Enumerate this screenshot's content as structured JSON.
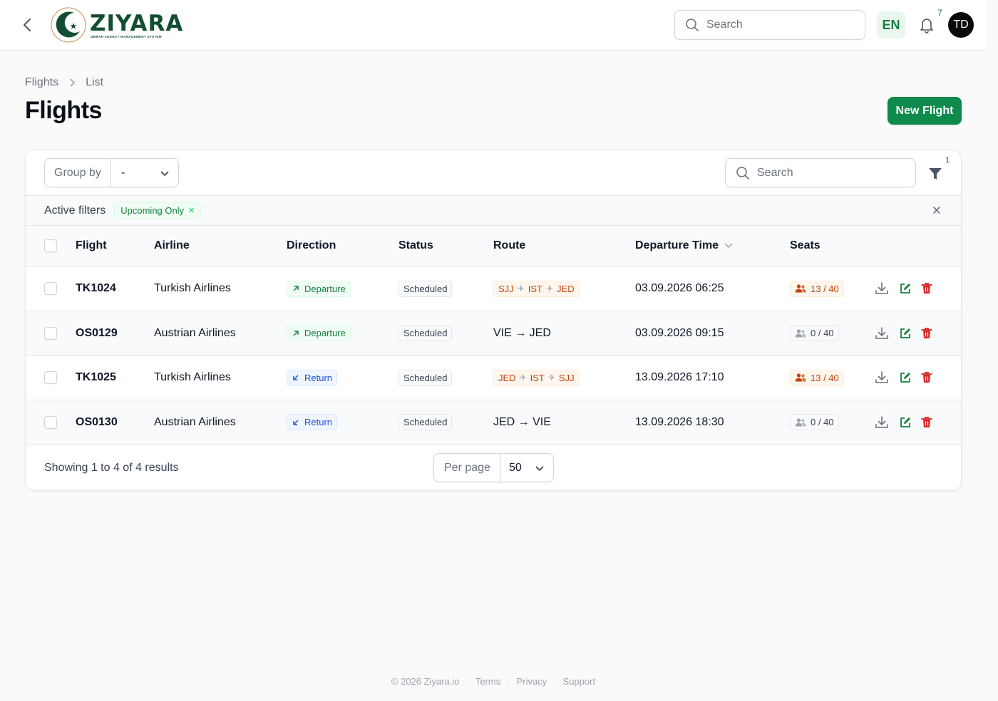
{
  "topbar": {
    "logo_word": "ZIYARA",
    "logo_sub": "UMRAH AGENCY MANAGEMENT SYSTEM",
    "search_placeholder": "Search",
    "lang": "EN",
    "notification_count": "7",
    "avatar_initials": "TD"
  },
  "breadcrumb": [
    "Flights",
    "List"
  ],
  "page": {
    "title": "Flights",
    "new_button": "New Flight"
  },
  "toolbar": {
    "group_by_label": "Group by",
    "group_by_value": "-",
    "search_placeholder": "Search",
    "filter_count": "1"
  },
  "active_filters": {
    "label": "Active filters",
    "chips": [
      "Upcoming Only"
    ]
  },
  "table": {
    "columns": [
      "Flight",
      "Airline",
      "Direction",
      "Status",
      "Route",
      "Departure Time",
      "Seats"
    ],
    "rows": [
      {
        "flight": "TK1024",
        "airline": "Turkish Airlines",
        "direction": "Departure",
        "status": "Scheduled",
        "route": [
          "SJJ",
          "IST",
          "JED"
        ],
        "route_text": "",
        "departure": "03.09.2026 06:25",
        "seats": "13 / 40"
      },
      {
        "flight": "OS0129",
        "airline": "Austrian Airlines",
        "direction": "Departure",
        "status": "Scheduled",
        "route": [],
        "route_text": "VIE → JED",
        "departure": "03.09.2026 09:15",
        "seats": "0 / 40"
      },
      {
        "flight": "TK1025",
        "airline": "Turkish Airlines",
        "direction": "Return",
        "status": "Scheduled",
        "route": [
          "JED",
          "IST",
          "SJJ"
        ],
        "route_text": "",
        "departure": "13.09.2026 17:10",
        "seats": "13 / 40"
      },
      {
        "flight": "OS0130",
        "airline": "Austrian Airlines",
        "direction": "Return",
        "status": "Scheduled",
        "route": [],
        "route_text": "JED → VIE",
        "departure": "13.09.2026 18:30",
        "seats": "0 / 40"
      }
    ]
  },
  "pagination": {
    "showing": "Showing 1 to 4 of 4 results",
    "per_page_label": "Per page",
    "per_page_value": "50"
  },
  "footer": {
    "copyright": "© 2026 Ziyara.io",
    "links": [
      "Terms",
      "Privacy",
      "Support"
    ]
  },
  "colors": {
    "brand": "#134e33",
    "accent": "#0e8a4c"
  }
}
